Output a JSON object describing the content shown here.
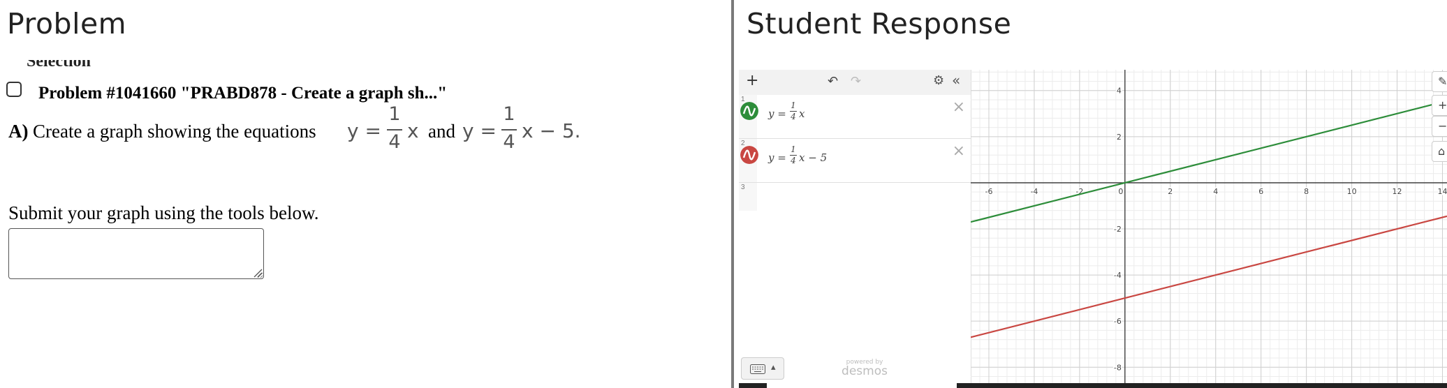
{
  "left_pane": {
    "heading": "Problem",
    "clipped_text": "Selection",
    "problem_title": "Problem #1041660 \"PRABD878 - Create a graph sh...\"",
    "question": {
      "part_label": "A)",
      "text_before": "Create a graph showing the equations",
      "eq1": {
        "lhs": "y =",
        "numerator": "1",
        "denominator": "4",
        "rhs": "x"
      },
      "connector": "and",
      "eq2": {
        "lhs": "y =",
        "numerator": "1",
        "denominator": "4",
        "rhs": "x − 5."
      }
    },
    "submit_instruction": "Submit your graph using the tools below.",
    "answer_value": ""
  },
  "right_pane": {
    "heading": "Student Response",
    "toolbar": {
      "add_label": "+",
      "undo_label": "↶",
      "redo_label": "↷",
      "settings_label": "⚙",
      "collapse_label": "«"
    },
    "expressions": [
      {
        "index": "1",
        "lhs": "y =",
        "numerator": "1",
        "denominator": "4",
        "rhs": "x",
        "color": "#2d8d3a",
        "delete_label": "×"
      },
      {
        "index": "2",
        "lhs": "y =",
        "numerator": "1",
        "denominator": "4",
        "rhs": "x − 5",
        "color": "#c94742",
        "delete_label": "×"
      },
      {
        "index": "3"
      }
    ],
    "keyboard_caret": "▴",
    "powered_by": "powered by",
    "brand": "desmos",
    "graph_controls": {
      "wrench": "✎",
      "zoom_in": "+",
      "zoom_out": "−",
      "home": "⌂"
    }
  },
  "chart_data": {
    "type": "line",
    "x_range": [
      -6.8,
      14.2
    ],
    "y_range": [
      -8.9,
      4.9
    ],
    "x_ticks": [
      -6,
      -4,
      -2,
      0,
      2,
      4,
      6,
      8,
      10,
      12,
      14
    ],
    "x_tick_labels": [
      "-6",
      "-4",
      "-2",
      "0",
      "2",
      "4",
      "6",
      "8",
      "10",
      "12",
      "14"
    ],
    "y_ticks": [
      -8,
      -6,
      -4,
      -2,
      2,
      4
    ],
    "y_tick_labels": [
      "-8",
      "-6",
      "-4",
      "-2",
      "2",
      "4"
    ],
    "grid": true,
    "series": [
      {
        "slope": 0.25,
        "intercept": 0,
        "color": "#2d8d3a"
      },
      {
        "slope": 0.25,
        "intercept": -5,
        "color": "#c94742"
      }
    ]
  }
}
